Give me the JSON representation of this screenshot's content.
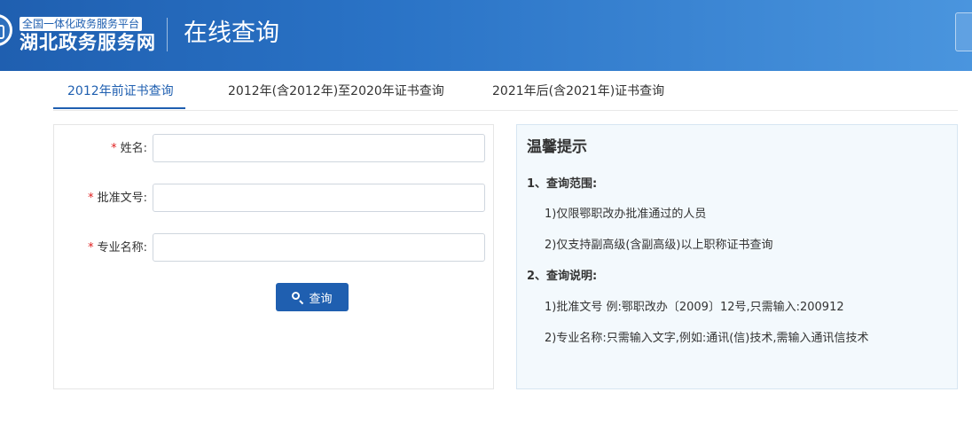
{
  "header": {
    "platform_label": "全国一体化政务服务平台",
    "site_name": "湖北政务服务网",
    "page_heading": "在线查询",
    "brand_color": "#1f5fb0"
  },
  "tabs": [
    {
      "label": "2012年前证书查询",
      "active": true
    },
    {
      "label": "2012年(含2012年)至2020年证书查询",
      "active": false
    },
    {
      "label": "2021年后(含2021年)证书查询",
      "active": false
    }
  ],
  "form": {
    "required_mark": "*",
    "fields": [
      {
        "label": "姓名",
        "value": "",
        "placeholder": ""
      },
      {
        "label": "批准文号",
        "value": "",
        "placeholder": ""
      },
      {
        "label": "专业名称",
        "value": "",
        "placeholder": ""
      }
    ],
    "submit_label": "查询",
    "submit_icon": "search-icon"
  },
  "tips": {
    "title": "温馨提示",
    "sections": [
      {
        "heading": "1、查询范围:",
        "items": [
          "1)仅限鄂职改办批准通过的人员",
          "2)仅支持副高级(含副高级)以上职称证书查询"
        ]
      },
      {
        "heading": "2、查询说明:",
        "items": [
          "1)批准文号 例:鄂职改办〔2009〕12号,只需输入:200912",
          "2)专业名称:只需输入文字,例如:通讯(信)技术,需输入通讯信技术"
        ]
      }
    ]
  }
}
